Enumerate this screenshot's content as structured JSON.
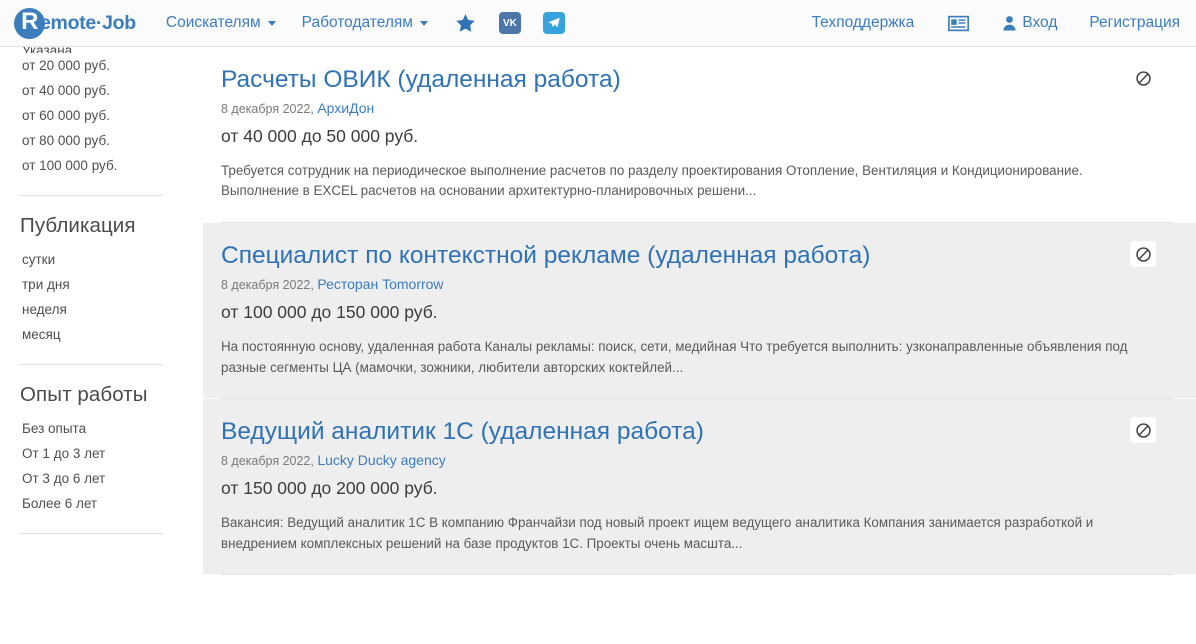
{
  "header": {
    "logo": {
      "mark": "R",
      "text": "emote·Job"
    },
    "nav": [
      {
        "label": "Соискателям",
        "has_caret": true
      },
      {
        "label": "Работодателям",
        "has_caret": true
      }
    ],
    "social": [
      {
        "icon": "star-icon",
        "label": "Избранное"
      },
      {
        "icon": "vk-icon",
        "label": "VK"
      },
      {
        "icon": "telegram-icon",
        "label": "Telegram"
      }
    ],
    "right": {
      "support_label": "Техподдержка",
      "news_icon_label": "Новости",
      "login_label": "Вход",
      "register_label": "Регистрация"
    }
  },
  "sidebar": {
    "groups": [
      {
        "title": "",
        "clipped_first": "Указана",
        "items": [
          "от 20 000 руб.",
          "от 40 000 руб.",
          "от 60 000 руб.",
          "от 80 000 руб.",
          "от 100 000 руб."
        ]
      },
      {
        "title": "Публикация",
        "items": [
          "сутки",
          "три дня",
          "неделя",
          "месяц"
        ]
      },
      {
        "title": "Опыт работы",
        "items": [
          "Без опыта",
          "От 1 до 3 лет",
          "От 3 до 6 лет",
          "Более 6 лет"
        ]
      }
    ]
  },
  "vacancies": [
    {
      "title": "Расчеты ОВИК (удаленная работа)",
      "date": "8 декабря 2022,",
      "company": "АрхиДон",
      "salary": "от 40 000 до 50 000 руб.",
      "description": "Требуется сотрудник на периодическое выполнение расчетов по разделу проектирования Отопление, Вентиляция и Кондиционирование. Выполнение в EXCEL расчетов на основании архитектурно-планировочных решени...",
      "block_icon": "block-icon"
    },
    {
      "title": "Специалист по контекстной рекламе (удаленная работа)",
      "date": "8 декабря 2022,",
      "company": "Ресторан Tomorrow",
      "salary": "от 100 000 до 150 000 руб.",
      "description": "На постоянную основу, удаленная работа Каналы рекламы: поиск, сети, медийная Что требуется выполнить: узконаправленные объявления под разные сегменты ЦА (мамочки, зожники, любители авторских коктейлей...",
      "block_icon": "block-icon"
    },
    {
      "title": "Ведущий аналитик 1С (удаленная работа)",
      "date": "8 декабря 2022,",
      "company": "Lucky Ducky agency",
      "salary": "от 150 000 до 200 000 руб.",
      "description": "Вакансия: Ведущий аналитик 1С В компанию Франчайзи под новый проект ищем ведущего аналитика Компания занимается разработкой и внедрением комплексных решений на базе продуктов 1С. Проекты очень масшта...",
      "block_icon": "block-icon"
    }
  ],
  "colors": {
    "brand_blue": "#3b7dbd",
    "link_blue": "#2f72b5",
    "card_gray": "#eeeeee",
    "header_bg": "#fbfbfb"
  }
}
